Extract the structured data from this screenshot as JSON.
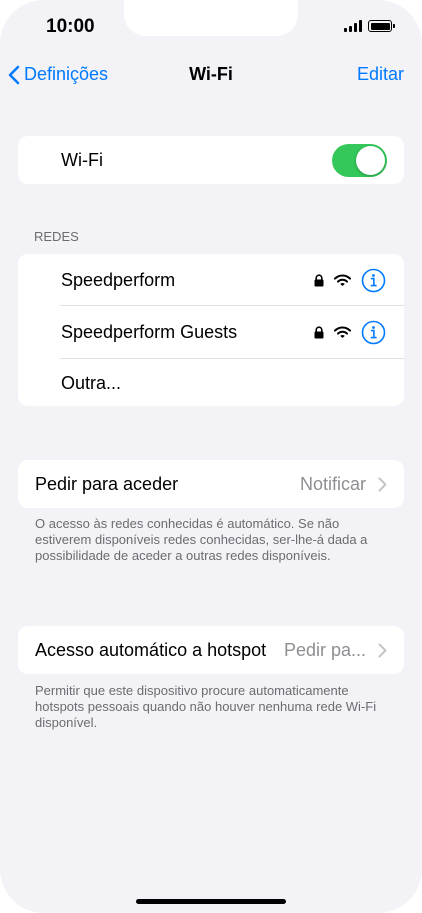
{
  "status_bar": {
    "time": "10:00"
  },
  "nav": {
    "back_label": "Definições",
    "title": "Wi-Fi",
    "edit_label": "Editar"
  },
  "wifi_toggle": {
    "label": "Wi-Fi",
    "on": true,
    "accent": "#34c759"
  },
  "networks": {
    "header": "REDES",
    "items": [
      {
        "name": "Speedperform",
        "locked": true
      },
      {
        "name": "Speedperform Guests",
        "locked": true
      }
    ],
    "other_label": "Outra..."
  },
  "ask_to_join": {
    "label": "Pedir para aceder",
    "value": "Notificar",
    "footer": "O acesso às redes conhecidas é automático. Se não estiverem disponíveis redes conhecidas, ser-lhe-á dada a possibilidade de aceder a outras redes disponíveis."
  },
  "auto_hotspot": {
    "label": "Acesso automático a hotspot",
    "value": "Pedir pa...",
    "footer": "Permitir que este dispositivo procure automaticamente hotspots pessoais quando não houver nenhuma rede Wi-Fi disponível."
  },
  "colors": {
    "accent": "#007aff",
    "background": "#f2f2f7",
    "secondary_text": "#6c6c70"
  }
}
